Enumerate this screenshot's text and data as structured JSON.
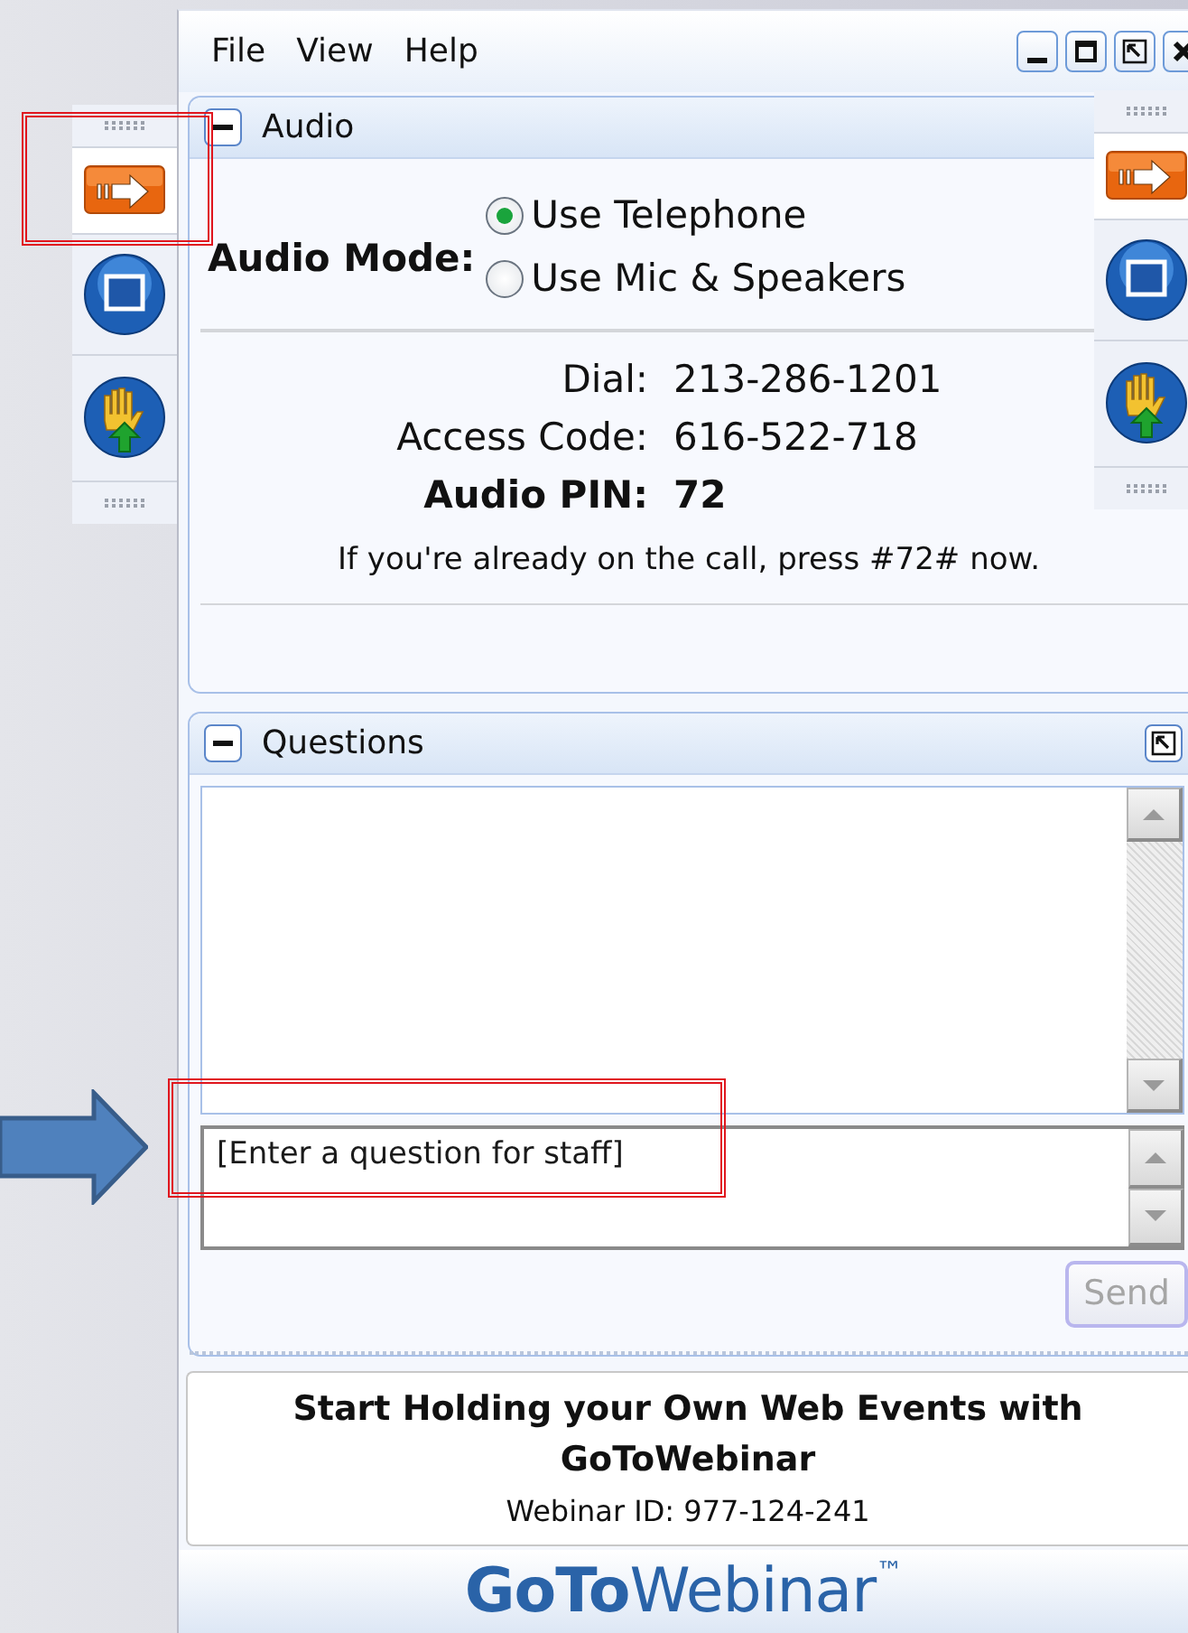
{
  "menu": [
    {
      "label": "File"
    },
    {
      "label": "View"
    },
    {
      "label": "Help"
    }
  ],
  "audio": {
    "title": "Audio",
    "expanded": true,
    "mode_label": "Audio Mode:",
    "options": [
      {
        "label": "Use Telephone",
        "selected": true
      },
      {
        "label": "Use Mic & Speakers",
        "selected": false
      }
    ],
    "details": [
      {
        "label": "Dial:",
        "value": "213-286-1201",
        "bold": false
      },
      {
        "label": "Access Code:",
        "value": "616-522-718",
        "bold": false
      },
      {
        "label": "Audio PIN:",
        "value": "72",
        "bold": true
      }
    ],
    "note": "If you're already on the call, press #72# now."
  },
  "questions": {
    "title": "Questions",
    "expanded": true,
    "placeholder": "[Enter a question for staff]",
    "send": {
      "label": "Send",
      "disabled": true
    }
  },
  "promo": {
    "headline": "Start Holding your Own Web Events with GoToWebinar",
    "webinar_id": "Webinar ID: 977-124-241"
  },
  "footer": {
    "logo": "**GoTo**Webinar$^{™}$"
  }
}
